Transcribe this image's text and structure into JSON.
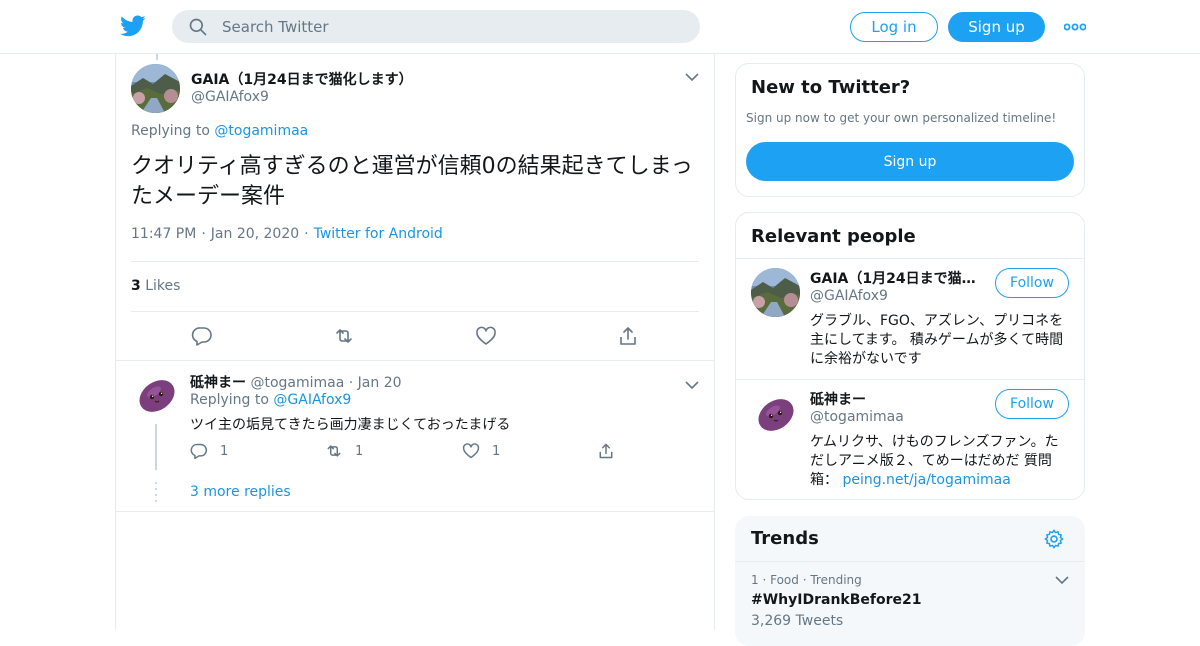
{
  "colors": {
    "accent": "#1da1f2",
    "link": "#1b95e0",
    "muted": "#657786",
    "border": "#e6ecf0"
  },
  "header": {
    "logo_icon": "twitter-bird-icon",
    "search_placeholder": "Search Twitter",
    "login_label": "Log in",
    "signup_label": "Sign up",
    "more_icon": "more-dots-icon"
  },
  "tweet": {
    "author_name": "GAIA（1月24日まで猫化します）",
    "author_handle": "@GAIAfox9",
    "replying_prefix": "Replying to",
    "replying_to": "@togamimaa",
    "text": "クオリティ高すぎるのと運営が信頼0の結果起きてしまったメーデー案件",
    "time": "11:47 PM",
    "date": "Jan 20, 2020",
    "source": "Twitter for Android",
    "likes_count": "3",
    "likes_label": "Likes"
  },
  "reply": {
    "name": "砥神まー",
    "handle": "@togamimaa",
    "date": "Jan 20",
    "replying_prefix": "Replying to",
    "replying_to": "@GAIAfox9",
    "text": "ツイ主の垢見てきたら画力凄まじくておったまげる",
    "reply_count": "1",
    "retweet_count": "1",
    "like_count": "1",
    "more_replies": "3 more replies"
  },
  "sidebar": {
    "new_title": "New to Twitter?",
    "new_sub": "Sign up now to get your own personalized timeline!",
    "new_button": "Sign up",
    "people_title": "Relevant people",
    "people": [
      {
        "name": "GAIA（1月24日まで猫化します）",
        "handle": "@GAIAfox9",
        "bio": "グラブル、FGO、アズレン、プリコネを主にしてます。 積みゲームが多くて時間に余裕がないです",
        "follow": "Follow"
      },
      {
        "name": "砥神まー",
        "handle": "@togamimaa",
        "bio": "ケムリクサ、けものフレンズファン。ただしアニメ版２、てめーはだめだ 質問箱：",
        "bio_link": "peing.net/ja/togamimaa",
        "follow": "Follow"
      }
    ],
    "trends_title": "Trends",
    "trends": [
      {
        "rank": "1",
        "category": "Food",
        "status": "Trending",
        "name": "#WhyIDrankBefore21",
        "count": "3,269 Tweets"
      }
    ]
  }
}
